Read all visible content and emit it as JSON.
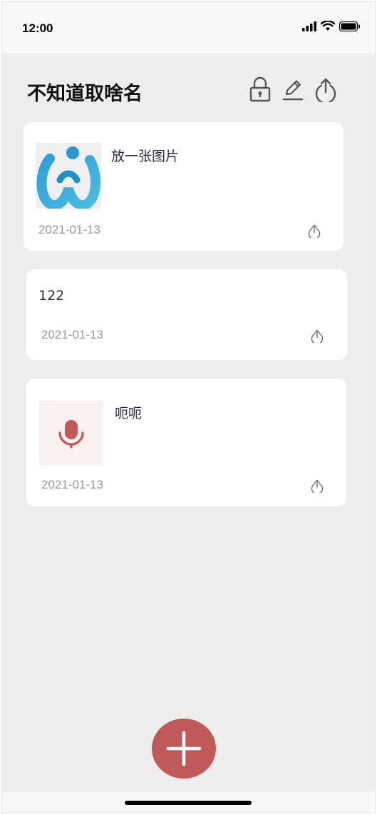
{
  "status_bar": {
    "time": "12:00"
  },
  "header": {
    "title": "不知道取啥名",
    "icons": [
      "lock-icon",
      "edit-icon",
      "share-icon"
    ]
  },
  "notes": [
    {
      "title": "放一张图片",
      "date": "2021-01-13",
      "thumbnail": "app-logo-image"
    },
    {
      "title": "122",
      "date": "2021-01-13",
      "thumbnail": null
    },
    {
      "title": "呃呃",
      "date": "2021-01-13",
      "thumbnail": "microphone-icon"
    }
  ],
  "fab": {
    "icon": "plus-icon"
  },
  "colors": {
    "accent": "#c05a58",
    "background": "#eeeeee",
    "card": "#ffffff",
    "date_text": "#999999"
  }
}
